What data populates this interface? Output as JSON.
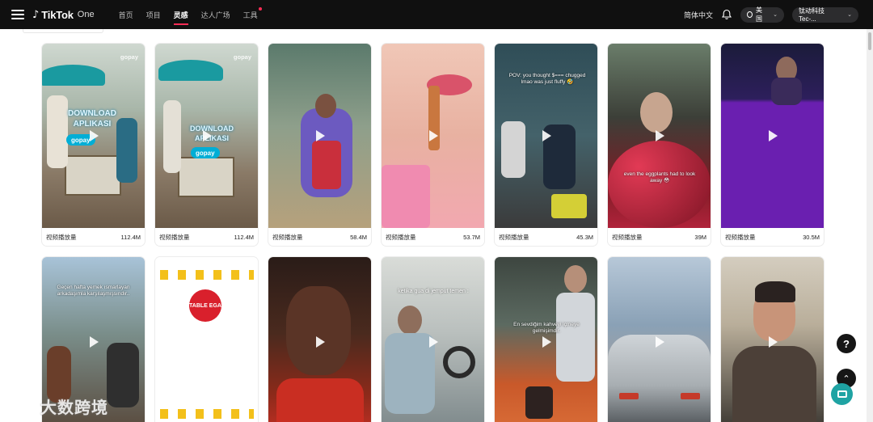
{
  "topbar": {
    "logo_note": "♪",
    "logo_text": "TikTok",
    "logo_suffix": "One",
    "nav": [
      {
        "label": "首页"
      },
      {
        "label": "项目"
      },
      {
        "label": "灵感"
      },
      {
        "label": "达人广场"
      },
      {
        "label": "工具"
      }
    ],
    "active_nav": "灵感",
    "language": "简体中文",
    "region": "美国",
    "account": "钛动科技Tec-..."
  },
  "cards_row1": [
    {
      "label": "视频播放量",
      "count": "112.4M",
      "watermark": "gopay",
      "brand": "gopay",
      "overlay": "DOWNLOAD APLIKASI"
    },
    {
      "label": "视频播放量",
      "count": "112.4M",
      "watermark": "gopay",
      "brand": "gopay",
      "overlay": "DOWNLOAD APLIKASI"
    },
    {
      "label": "视频播放量",
      "count": "58.4M"
    },
    {
      "label": "视频播放量",
      "count": "53.7M"
    },
    {
      "label": "视频播放量",
      "count": "45.3M",
      "overlay": "POV: you thought $=== chugged lmao was just fluffy 🤣"
    },
    {
      "label": "视频播放量",
      "count": "39M",
      "overlay": "even the eggplants had to look away 😳"
    },
    {
      "label": "视频播放量",
      "count": "30.5M"
    }
  ],
  "cards_row2": [
    {
      "overlay": "Geçen hafta yemek ısmarlayan arkadaşımla karşılaşmışsındır.."
    },
    {
      "overlay": "TABLE EGA"
    },
    {
      "overlay": ""
    },
    {
      "overlay": "ketika gua di jemput temen :"
    },
    {
      "overlay": "En sevdiğim kahveyi içmeye gelmişimdir."
    },
    {
      "overlay": ""
    },
    {
      "overlay": ""
    }
  ],
  "floating": {
    "help_icon": "?",
    "top_icon": "⌃"
  },
  "brandmark": {
    "text": "大数跨境"
  },
  "colors": {
    "accent": "#fe2c55",
    "topbar": "#101010",
    "chat": "#1fa3a3"
  }
}
